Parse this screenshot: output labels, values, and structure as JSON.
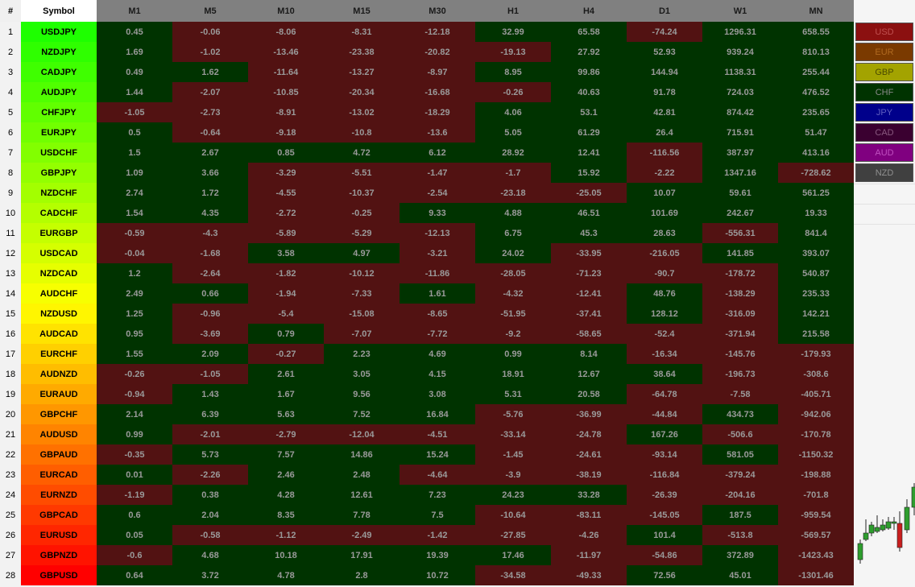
{
  "header": {
    "num_label": "#",
    "symbol_label": "Symbol",
    "timeframes": [
      "M1",
      "M5",
      "M10",
      "M15",
      "M30",
      "H1",
      "H4",
      "D1",
      "W1",
      "MN"
    ]
  },
  "colors": {
    "positive": "#003300",
    "negative": "#521212",
    "value_text": "#9a9a9a"
  },
  "rows": [
    {
      "num": "1",
      "symbol": "USDJPY",
      "values": [
        "0.45",
        "-0.06",
        "-8.06",
        "-8.31",
        "-12.18",
        "32.99",
        "65.58",
        "-74.24",
        "1296.31",
        "658.55"
      ]
    },
    {
      "num": "2",
      "symbol": "NZDJPY",
      "values": [
        "1.69",
        "-1.02",
        "-13.46",
        "-23.38",
        "-20.82",
        "-19.13",
        "27.92",
        "52.93",
        "939.24",
        "810.13"
      ]
    },
    {
      "num": "3",
      "symbol": "CADJPY",
      "values": [
        "0.49",
        "1.62",
        "-11.64",
        "-13.27",
        "-8.97",
        "8.95",
        "99.86",
        "144.94",
        "1138.31",
        "255.44"
      ]
    },
    {
      "num": "4",
      "symbol": "AUDJPY",
      "values": [
        "1.44",
        "-2.07",
        "-10.85",
        "-20.34",
        "-16.68",
        "-0.26",
        "40.63",
        "91.78",
        "724.03",
        "476.52"
      ]
    },
    {
      "num": "5",
      "symbol": "CHFJPY",
      "values": [
        "-1.05",
        "-2.73",
        "-8.91",
        "-13.02",
        "-18.29",
        "4.06",
        "53.1",
        "42.81",
        "874.42",
        "235.65"
      ]
    },
    {
      "num": "6",
      "symbol": "EURJPY",
      "values": [
        "0.5",
        "-0.64",
        "-9.18",
        "-10.8",
        "-13.6",
        "5.05",
        "61.29",
        "26.4",
        "715.91",
        "51.47"
      ]
    },
    {
      "num": "7",
      "symbol": "USDCHF",
      "values": [
        "1.5",
        "2.67",
        "0.85",
        "4.72",
        "6.12",
        "28.92",
        "12.41",
        "-116.56",
        "387.97",
        "413.16"
      ]
    },
    {
      "num": "8",
      "symbol": "GBPJPY",
      "values": [
        "1.09",
        "3.66",
        "-3.29",
        "-5.51",
        "-1.47",
        "-1.7",
        "15.92",
        "-2.22",
        "1347.16",
        "-728.62"
      ]
    },
    {
      "num": "9",
      "symbol": "NZDCHF",
      "values": [
        "2.74",
        "1.72",
        "-4.55",
        "-10.37",
        "-2.54",
        "-23.18",
        "-25.05",
        "10.07",
        "59.61",
        "561.25"
      ]
    },
    {
      "num": "10",
      "symbol": "CADCHF",
      "values": [
        "1.54",
        "4.35",
        "-2.72",
        "-0.25",
        "9.33",
        "4.88",
        "46.51",
        "101.69",
        "242.67",
        "19.33"
      ]
    },
    {
      "num": "11",
      "symbol": "EURGBP",
      "values": [
        "-0.59",
        "-4.3",
        "-5.89",
        "-5.29",
        "-12.13",
        "6.75",
        "45.3",
        "28.63",
        "-556.31",
        "841.4"
      ]
    },
    {
      "num": "12",
      "symbol": "USDCAD",
      "values": [
        "-0.04",
        "-1.68",
        "3.58",
        "4.97",
        "-3.21",
        "24.02",
        "-33.95",
        "-216.05",
        "141.85",
        "393.07"
      ]
    },
    {
      "num": "13",
      "symbol": "NZDCAD",
      "values": [
        "1.2",
        "-2.64",
        "-1.82",
        "-10.12",
        "-11.86",
        "-28.05",
        "-71.23",
        "-90.7",
        "-178.72",
        "540.87"
      ]
    },
    {
      "num": "14",
      "symbol": "AUDCHF",
      "values": [
        "2.49",
        "0.66",
        "-1.94",
        "-7.33",
        "1.61",
        "-4.32",
        "-12.41",
        "48.76",
        "-138.29",
        "235.33"
      ]
    },
    {
      "num": "15",
      "symbol": "NZDUSD",
      "values": [
        "1.25",
        "-0.96",
        "-5.4",
        "-15.08",
        "-8.65",
        "-51.95",
        "-37.41",
        "128.12",
        "-316.09",
        "142.21"
      ]
    },
    {
      "num": "16",
      "symbol": "AUDCAD",
      "values": [
        "0.95",
        "-3.69",
        "0.79",
        "-7.07",
        "-7.72",
        "-9.2",
        "-58.65",
        "-52.4",
        "-371.94",
        "215.58"
      ]
    },
    {
      "num": "17",
      "symbol": "EURCHF",
      "values": [
        "1.55",
        "2.09",
        "-0.27",
        "2.23",
        "4.69",
        "0.99",
        "8.14",
        "-16.34",
        "-145.76",
        "-179.93"
      ]
    },
    {
      "num": "18",
      "symbol": "AUDNZD",
      "values": [
        "-0.26",
        "-1.05",
        "2.61",
        "3.05",
        "4.15",
        "18.91",
        "12.67",
        "38.64",
        "-196.73",
        "-308.6"
      ]
    },
    {
      "num": "19",
      "symbol": "EURAUD",
      "values": [
        "-0.94",
        "1.43",
        "1.67",
        "9.56",
        "3.08",
        "5.31",
        "20.58",
        "-64.78",
        "-7.58",
        "-405.71"
      ]
    },
    {
      "num": "20",
      "symbol": "GBPCHF",
      "values": [
        "2.14",
        "6.39",
        "5.63",
        "7.52",
        "16.84",
        "-5.76",
        "-36.99",
        "-44.84",
        "434.73",
        "-942.06"
      ]
    },
    {
      "num": "21",
      "symbol": "AUDUSD",
      "values": [
        "0.99",
        "-2.01",
        "-2.79",
        "-12.04",
        "-4.51",
        "-33.14",
        "-24.78",
        "167.26",
        "-506.6",
        "-170.78"
      ]
    },
    {
      "num": "22",
      "symbol": "GBPAUD",
      "values": [
        "-0.35",
        "5.73",
        "7.57",
        "14.86",
        "15.24",
        "-1.45",
        "-24.61",
        "-93.14",
        "581.05",
        "-1150.32"
      ]
    },
    {
      "num": "23",
      "symbol": "EURCAD",
      "values": [
        "0.01",
        "-2.26",
        "2.46",
        "2.48",
        "-4.64",
        "-3.9",
        "-38.19",
        "-116.84",
        "-379.24",
        "-198.88"
      ]
    },
    {
      "num": "24",
      "symbol": "EURNZD",
      "values": [
        "-1.19",
        "0.38",
        "4.28",
        "12.61",
        "7.23",
        "24.23",
        "33.28",
        "-26.39",
        "-204.16",
        "-701.8"
      ]
    },
    {
      "num": "25",
      "symbol": "GBPCAD",
      "values": [
        "0.6",
        "2.04",
        "8.35",
        "7.78",
        "7.5",
        "-10.64",
        "-83.11",
        "-145.05",
        "187.5",
        "-959.54"
      ]
    },
    {
      "num": "26",
      "symbol": "EURUSD",
      "values": [
        "0.05",
        "-0.58",
        "-1.12",
        "-2.49",
        "-1.42",
        "-27.85",
        "-4.26",
        "101.4",
        "-513.8",
        "-569.57"
      ]
    },
    {
      "num": "27",
      "symbol": "GBPNZD",
      "values": [
        "-0.6",
        "4.68",
        "10.18",
        "17.91",
        "19.39",
        "17.46",
        "-11.97",
        "-54.86",
        "372.89",
        "-1423.43"
      ]
    },
    {
      "num": "28",
      "symbol": "GBPUSD",
      "values": [
        "0.64",
        "3.72",
        "4.78",
        "2.8",
        "10.72",
        "-34.58",
        "-49.33",
        "72.56",
        "45.01",
        "-1301.46"
      ]
    }
  ],
  "currencies": [
    {
      "label": "USD",
      "bg": "#8b1010",
      "fg": "#c05050"
    },
    {
      "label": "EUR",
      "bg": "#7a3a00",
      "fg": "#b06a20"
    },
    {
      "label": "GBP",
      "bg": "#a3a300",
      "fg": "#4a4a00"
    },
    {
      "label": "CHF",
      "bg": "#003300",
      "fg": "#8a8a8a"
    },
    {
      "label": "JPY",
      "bg": "#00008b",
      "fg": "#6060c0"
    },
    {
      "label": "CAD",
      "bg": "#3a0030",
      "fg": "#8a5a80"
    },
    {
      "label": "AUD",
      "bg": "#800080",
      "fg": "#c050c0"
    },
    {
      "label": "NZD",
      "bg": "#404040",
      "fg": "#909090"
    }
  ]
}
